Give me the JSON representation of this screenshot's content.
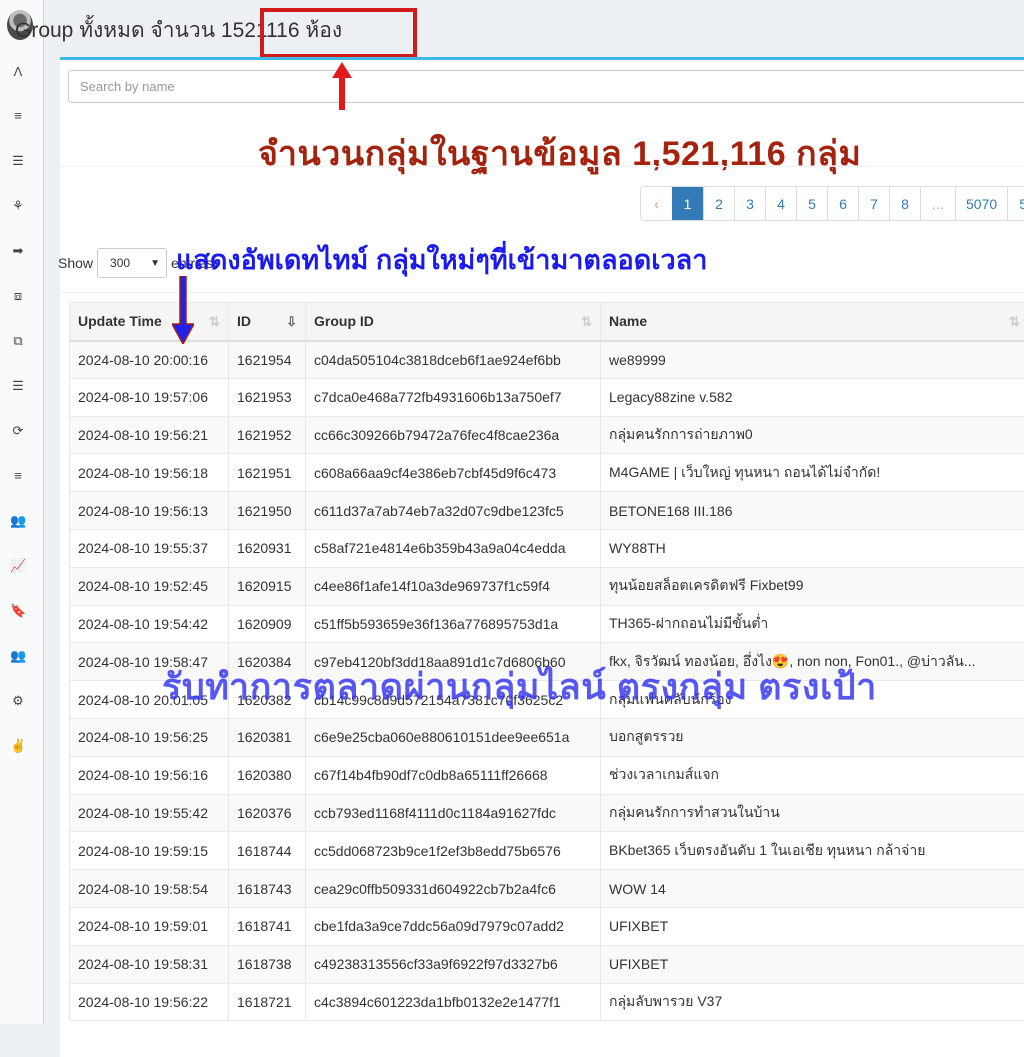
{
  "header": {
    "title": "Group ทั้งหมด จำนวน 1521116 ห้อง"
  },
  "sidebar": {
    "items": [
      {
        "icon": "app-icon",
        "glyph": "Λ"
      },
      {
        "icon": "align-left-icon",
        "glyph": "≡"
      },
      {
        "icon": "menu-icon",
        "glyph": "☰"
      },
      {
        "icon": "tree-icon",
        "glyph": "⚘"
      },
      {
        "icon": "sign-out-icon",
        "glyph": "➡"
      },
      {
        "icon": "crop-icon",
        "glyph": "⧈"
      },
      {
        "icon": "clone-icon",
        "glyph": "⧉"
      },
      {
        "icon": "list-icon",
        "glyph": "☰"
      },
      {
        "icon": "refresh-icon",
        "glyph": "⟳"
      },
      {
        "icon": "align-left-icon",
        "glyph": "≡"
      },
      {
        "icon": "users-icon",
        "glyph": "👥"
      },
      {
        "icon": "line-chart-icon",
        "glyph": "📈"
      },
      {
        "icon": "bookmark-icon",
        "glyph": "🔖"
      },
      {
        "icon": "users-icon",
        "glyph": "👥"
      },
      {
        "icon": "gear-icon",
        "glyph": "⚙"
      },
      {
        "icon": "peace-hand-icon",
        "glyph": "✌"
      }
    ]
  },
  "search": {
    "placeholder": "Search by name",
    "value": ""
  },
  "annotations": {
    "db_count": "จำนวนกลุ่มในฐานข้อมูล  1,521,116 กลุ่ม",
    "realtime": "แสดงอัพเดทไทม์ กลุ่มใหม่ๆที่เข้ามาตลอดเวลา",
    "marketing": "รับทำการตลาดผ่านกลุ่มไลน์ ตรงกลุ่ม ตรงเป้า"
  },
  "pagination": {
    "prev": "‹",
    "pages": [
      "1",
      "2",
      "3",
      "4",
      "5",
      "6",
      "7",
      "8",
      "…",
      "5070",
      "5"
    ],
    "active": "1"
  },
  "entries": {
    "show_label": "Show",
    "selected": "300",
    "suffix_label": "entries"
  },
  "table": {
    "columns": [
      "Update Time",
      "ID",
      "Group ID",
      "Name"
    ],
    "rows": [
      [
        "2024-08-10 20:00:16",
        "1621954",
        "c04da505104c3818dceb6f1ae924ef6bb",
        "we89999"
      ],
      [
        "2024-08-10 19:57:06",
        "1621953",
        "c7dca0e468a772fb4931606b13a750ef7",
        "Legacy88zine v.582"
      ],
      [
        "2024-08-10 19:56:21",
        "1621952",
        "cc66c309266b79472a76fec4f8cae236a",
        "กลุ่มคนรักการถ่ายภาพ0"
      ],
      [
        "2024-08-10 19:56:18",
        "1621951",
        "c608a66aa9cf4e386eb7cbf45d9f6c473",
        "M4GAME | เว็บใหญ่ ทุนหนา ถอนได้ไม่จำกัด!"
      ],
      [
        "2024-08-10 19:56:13",
        "1621950",
        "c611d37a7ab74eb7a32d07c9dbe123fc5",
        "BETONE168 III.186"
      ],
      [
        "2024-08-10 19:55:37",
        "1620931",
        "c58af721e4814e6b359b43a9a04c4edda",
        "WY88TH"
      ],
      [
        "2024-08-10 19:52:45",
        "1620915",
        "c4ee86f1afe14f10a3de969737f1c59f4",
        "ทุนน้อยสล็อตเครดิตฟรี Fixbet99"
      ],
      [
        "2024-08-10 19:54:42",
        "1620909",
        "c51ff5b593659e36f136a776895753d1a",
        "TH365-ฝากถอนไม่มีขั้นต่ำ"
      ],
      [
        "2024-08-10 19:58:47",
        "1620384",
        "c97eb4120bf3dd18aa891d1c7d6806b60",
        "fkx, จิรวัฒน์ ทองน้อย, อึ่งไง😍, non non, Fon01., @บ่าวลัน..."
      ],
      [
        "2024-08-10 20:01:05",
        "1620382",
        "cb14c99c8d9d572154a7381c70f3625c2",
        "กลุ่มแฟนคลับนักร้อง"
      ],
      [
        "2024-08-10 19:56:25",
        "1620381",
        "c6e9e25cba060e880610151dee9ee651a",
        "บอกสูตรรวย"
      ],
      [
        "2024-08-10 19:56:16",
        "1620380",
        "c67f14b4fb90df7c0db8a65111ff26668",
        "ช่วงเวลาเกมส์แจก"
      ],
      [
        "2024-08-10 19:55:42",
        "1620376",
        "ccb793ed1168f4111d0c1184a91627fdc",
        "กลุ่มคนรักการทำสวนในบ้าน"
      ],
      [
        "2024-08-10 19:59:15",
        "1618744",
        "cc5dd068723b9ce1f2ef3b8edd75b6576",
        "BKbet365 เว็บตรงอันดับ 1 ในเอเชีย ทุนหนา กล้าจ่าย"
      ],
      [
        "2024-08-10 19:58:54",
        "1618743",
        "cea29c0ffb509331d604922cb7b2a4fc6",
        "WOW 14"
      ],
      [
        "2024-08-10 19:59:01",
        "1618741",
        "cbe1fda3a9ce7ddc56a09d7979c07add2",
        "UFIXBET"
      ],
      [
        "2024-08-10 19:58:31",
        "1618738",
        "c49238313556cf33a9f6922f97d3327b6",
        "UFIXBET"
      ],
      [
        "2024-08-10 19:56:22",
        "1618721",
        "c4c3894c601223da1bfb0132e2e1477f1",
        "กลุ่มลับพารวย V37"
      ]
    ]
  },
  "colors": {
    "accent": "#3cb9e6",
    "pagination_active": "#337ab7",
    "annotation_red": "#a3230e",
    "annotation_blue": "#1a1aee",
    "highlight_box": "#d11a1a"
  }
}
